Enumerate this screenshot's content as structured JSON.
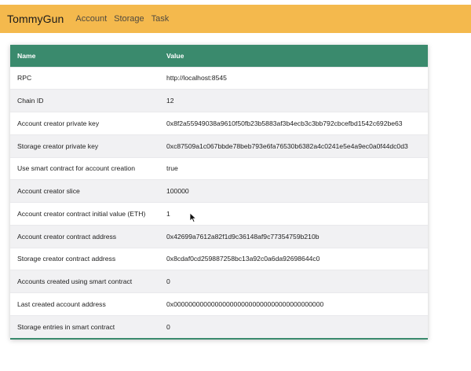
{
  "nav": {
    "brand": "TommyGun",
    "links": [
      "Account",
      "Storage",
      "Task"
    ]
  },
  "table": {
    "headers": {
      "name": "Name",
      "value": "Value"
    },
    "rows": [
      {
        "name": "RPC",
        "value": "http://localhost:8545"
      },
      {
        "name": "Chain ID",
        "value": "12"
      },
      {
        "name": "Account creator private key",
        "value": "0x8f2a55949038a9610f50fb23b5883af3b4ecb3c3bb792cbcefbd1542c692be63"
      },
      {
        "name": "Storage creator private key",
        "value": "0xc87509a1c067bbde78beb793e6fa76530b6382a4c0241e5e4a9ec0a0f44dc0d3"
      },
      {
        "name": "Use smart contract for account creation",
        "value": "true"
      },
      {
        "name": "Account creator slice",
        "value": "100000"
      },
      {
        "name": "Account creator contract initial value (ETH)",
        "value": "1"
      },
      {
        "name": "Account creator contract address",
        "value": "0x42699a7612a82f1d9c36148af9c77354759b210b"
      },
      {
        "name": "Storage creator contract address",
        "value": "0x8cdaf0cd259887258bc13a92c0a6da92698644c0"
      },
      {
        "name": "Accounts created using smart contract",
        "value": "0"
      },
      {
        "name": "Last created account address",
        "value": "0x0000000000000000000000000000000000000000"
      },
      {
        "name": "Storage entries in smart contract",
        "value": "0"
      }
    ]
  },
  "colors": {
    "navbar": "#f4b94d",
    "table_header": "#3a8a6d",
    "row_alt": "#f1f1f3"
  }
}
